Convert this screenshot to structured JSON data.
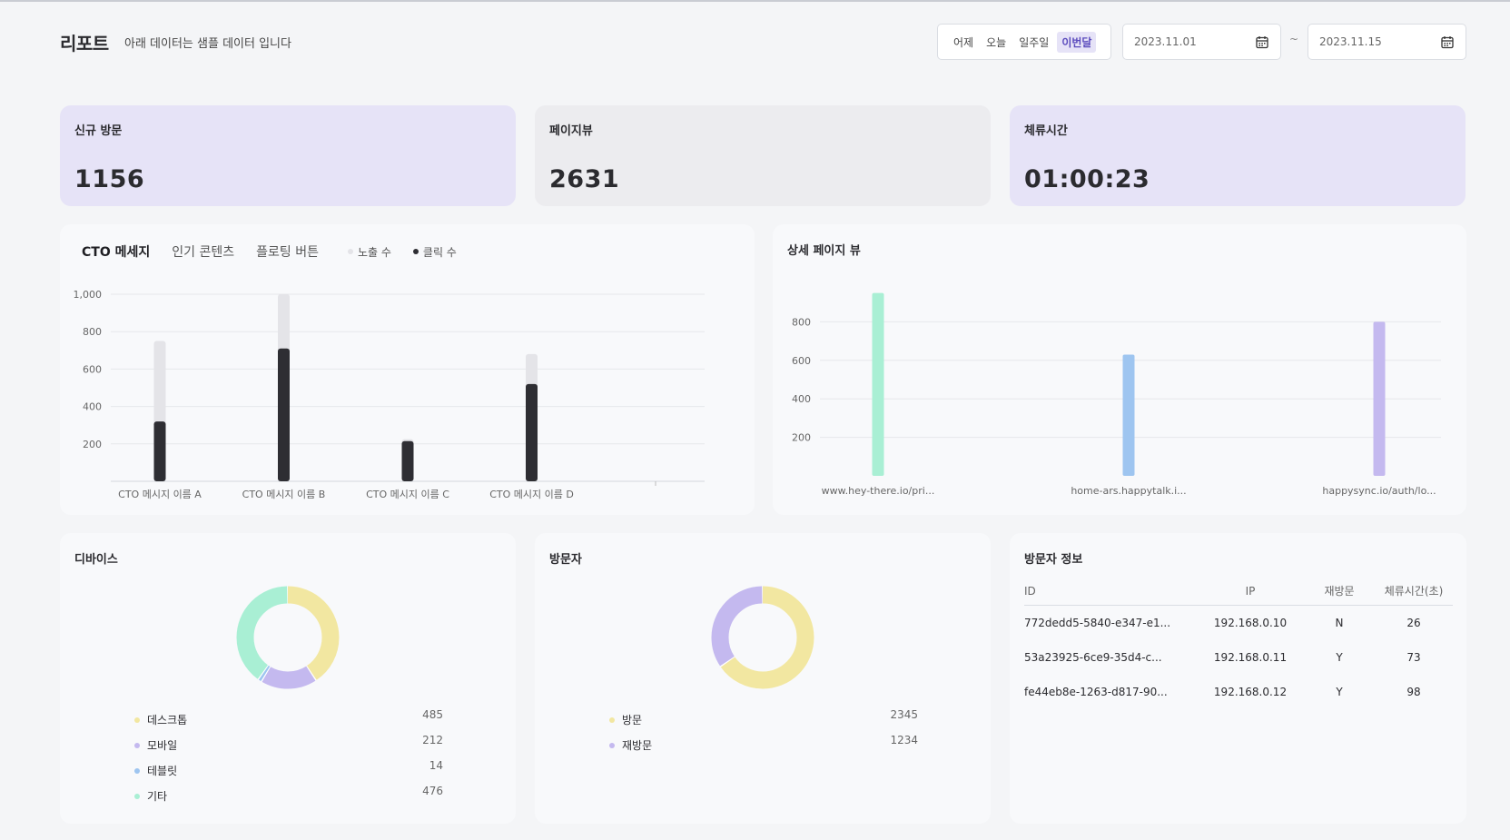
{
  "header": {
    "title": "리포트",
    "subtitle": "아래 데이터는 샘플 데이터 입니다",
    "range_tabs": [
      {
        "label": "어제",
        "active": false
      },
      {
        "label": "오늘",
        "active": false
      },
      {
        "label": "일주일",
        "active": false
      },
      {
        "label": "이번달",
        "active": true
      }
    ],
    "start_date": "2023.11.01",
    "end_date": "2023.11.15",
    "date_separator": "~"
  },
  "stats": [
    {
      "label": "신규 방문",
      "value": "1156"
    },
    {
      "label": "페이지뷰",
      "value": "2631"
    },
    {
      "label": "체류시간",
      "value": "01:00:23"
    }
  ],
  "cto_panel": {
    "tabs": [
      {
        "label": "CTO 메세지",
        "active": true
      },
      {
        "label": "인기 콘텐츠",
        "active": false
      },
      {
        "label": "플로팅 버튼",
        "active": false
      }
    ],
    "legend": [
      {
        "label": "노출 수",
        "color": "#e4e4e8"
      },
      {
        "label": "클릭 수",
        "color": "#2e2e33"
      }
    ]
  },
  "detail_panel": {
    "title": "상세 페이지 뷰"
  },
  "device_panel": {
    "title": "디바이스",
    "items": [
      {
        "label": "데스크톱",
        "value": "485",
        "color": "#f2e7a1"
      },
      {
        "label": "모바일",
        "value": "212",
        "color": "#c4b9ef"
      },
      {
        "label": "테블릿",
        "value": "14",
        "color": "#9ec5f0"
      },
      {
        "label": "기타",
        "value": "476",
        "color": "#a9efd4"
      }
    ]
  },
  "visitor_panel": {
    "title": "방문자",
    "items": [
      {
        "label": "방문",
        "value": "2345",
        "color": "#f2e7a1"
      },
      {
        "label": "재방문",
        "value": "1234",
        "color": "#c4b9ef"
      }
    ]
  },
  "visitor_info": {
    "title": "방문자 정보",
    "columns": [
      "ID",
      "IP",
      "재방문",
      "체류시간(초)"
    ],
    "rows": [
      [
        "772dedd5-5840-e347-e1...",
        "192.168.0.10",
        "N",
        "26"
      ],
      [
        "53a23925-6ce9-35d4-c...",
        "192.168.0.11",
        "Y",
        "73"
      ],
      [
        "fe44eb8e-1263-d817-90...",
        "192.168.0.12",
        "Y",
        "98"
      ]
    ]
  },
  "chart_data": [
    {
      "type": "bar",
      "categories": [
        "CTO 메시지 이름 A",
        "CTO 메시지 이름 B",
        "CTO 메시지 이름 C",
        "CTO 메시지 이름 D"
      ],
      "series": [
        {
          "name": "노출 수",
          "values": [
            750,
            1000,
            225,
            680
          ],
          "color": "#e4e4e8"
        },
        {
          "name": "클릭 수",
          "values": [
            320,
            710,
            215,
            520
          ],
          "color": "#2e2e33"
        }
      ],
      "ylim": [
        0,
        1000
      ],
      "yticks": [
        "200",
        "400",
        "600",
        "800",
        "1,000"
      ],
      "ytick_values": [
        200,
        400,
        600,
        800,
        1000
      ],
      "grid": true
    },
    {
      "type": "bar",
      "categories": [
        "www.hey-there.io/pri...",
        "home-ars.happytalk.i...",
        "happysync.io/auth/lo..."
      ],
      "values": [
        950,
        630,
        800
      ],
      "colors": [
        "#a9efd4",
        "#9ec5f0",
        "#c4b9ef"
      ],
      "ylim": [
        0,
        1000
      ],
      "yticks": [
        "200",
        "400",
        "600",
        "800"
      ],
      "ytick_values": [
        200,
        400,
        600,
        800
      ],
      "grid": true
    },
    {
      "type": "pie",
      "donut": true,
      "labels": [
        "데스크톱",
        "모바일",
        "테블릿",
        "기타"
      ],
      "values": [
        485,
        212,
        14,
        476
      ],
      "colors": [
        "#f2e7a1",
        "#c4b9ef",
        "#9ec5f0",
        "#a9efd4"
      ]
    },
    {
      "type": "pie",
      "donut": true,
      "labels": [
        "방문",
        "재방문"
      ],
      "values": [
        2345,
        1234
      ],
      "colors": [
        "#f2e7a1",
        "#c4b9ef"
      ]
    }
  ]
}
